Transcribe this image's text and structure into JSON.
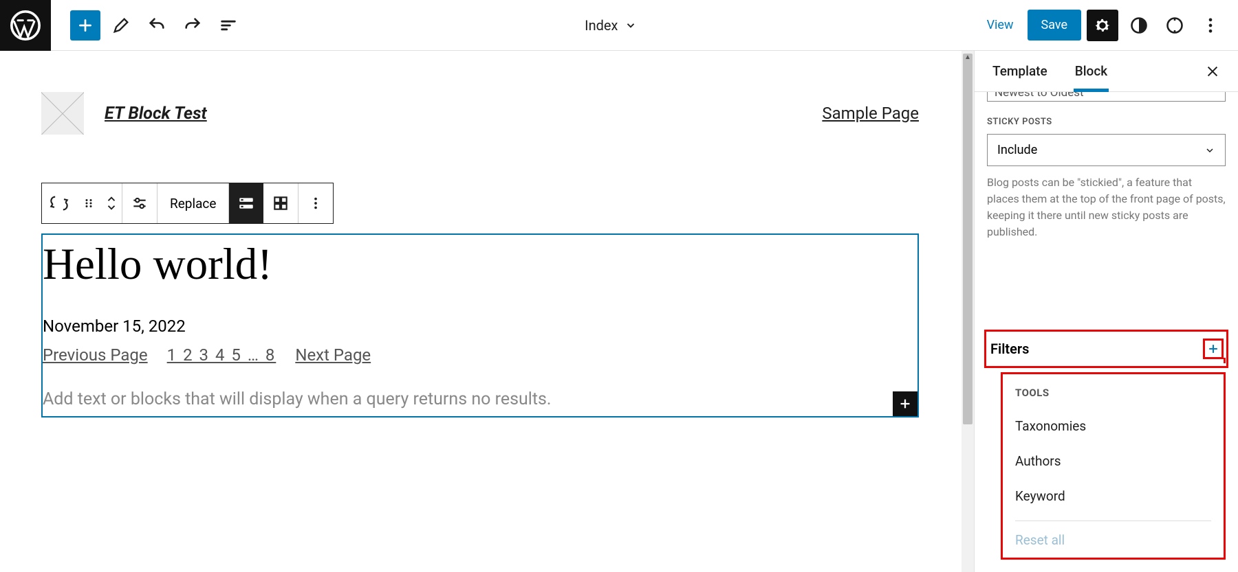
{
  "topbar": {
    "document": "Index",
    "view": "View",
    "save": "Save"
  },
  "site": {
    "title": "ET Block Test",
    "nav_link": "Sample Page"
  },
  "block_toolbar": {
    "replace": "Replace"
  },
  "post": {
    "title": "Hello world!",
    "date": "November 15, 2022"
  },
  "pagination": {
    "prev": "Previous Page",
    "pages": "1 2 3 4 5 … 8",
    "next": "Next Page"
  },
  "no_results_placeholder": "Add text or blocks that will display when a query returns no results.",
  "sidebar": {
    "tabs": {
      "template": "Template",
      "block": "Block"
    },
    "order_cut": "Newest to Oldest",
    "sticky": {
      "label": "STICKY POSTS",
      "value": "Include",
      "help": "Blog posts can be \"stickied\", a feature that places them at the top of the front page of posts, keeping it there until new sticky posts are published."
    },
    "filters": {
      "heading": "Filters",
      "tools_label": "TOOLS",
      "items": [
        "Taxonomies",
        "Authors",
        "Keyword"
      ],
      "reset": "Reset all"
    }
  }
}
